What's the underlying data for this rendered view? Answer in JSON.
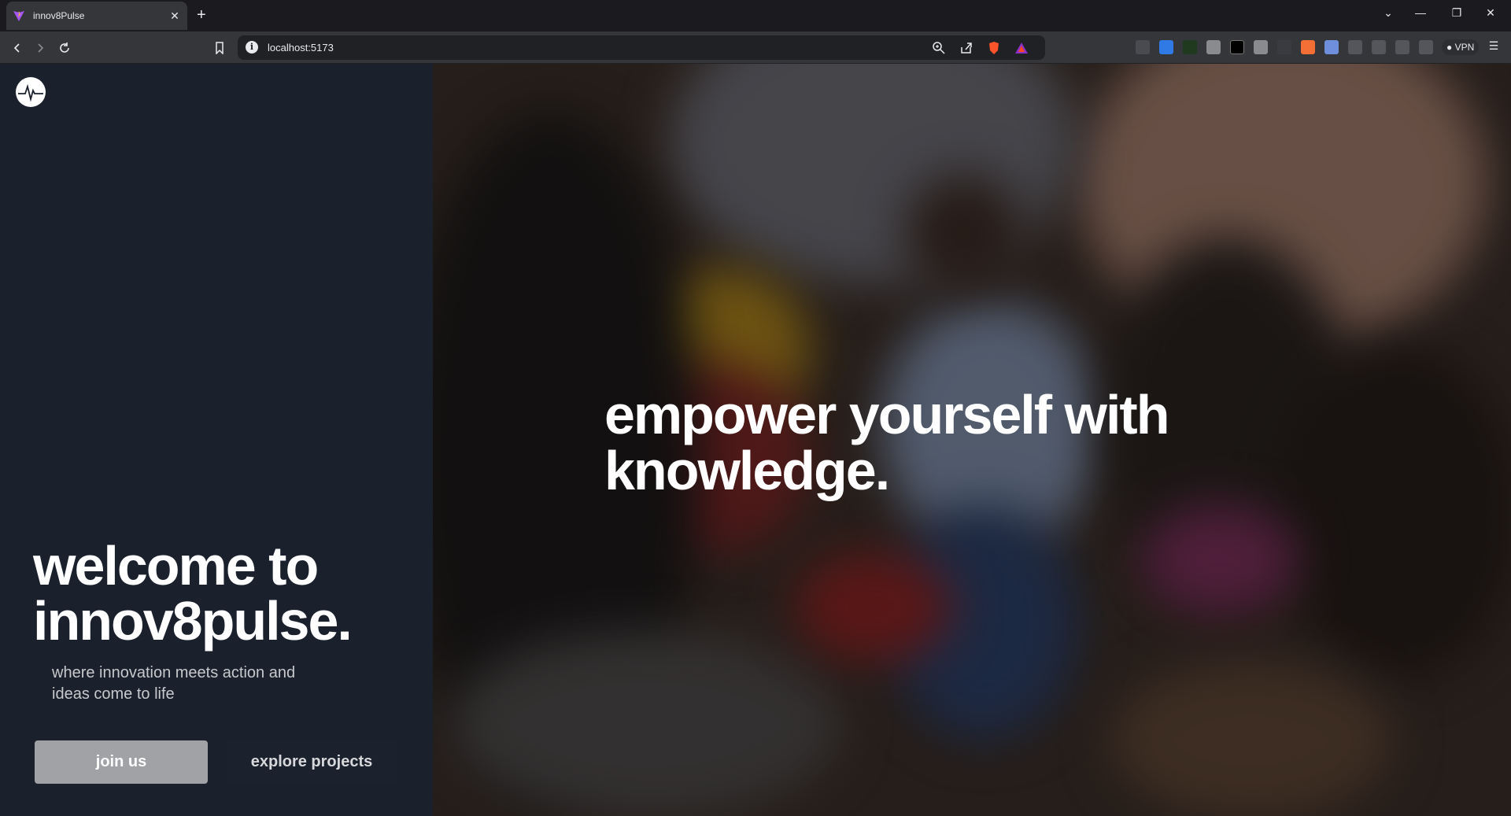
{
  "browser": {
    "tab_title": "innov8Pulse",
    "url": "localhost:5173",
    "vpn_label": "VPN",
    "colors": {
      "chrome": "#35363a",
      "tabstrip": "#1b1b1f",
      "brave_orange": "#fb542b"
    }
  },
  "left_panel": {
    "background": "#1a202c",
    "heading": "welcome to innov8pulse.",
    "tagline": "where innovation meets action and ideas come to life",
    "join_button": "join us",
    "explore_button": "explore projects"
  },
  "hero": {
    "headline": "empower yourself with knowledge."
  }
}
